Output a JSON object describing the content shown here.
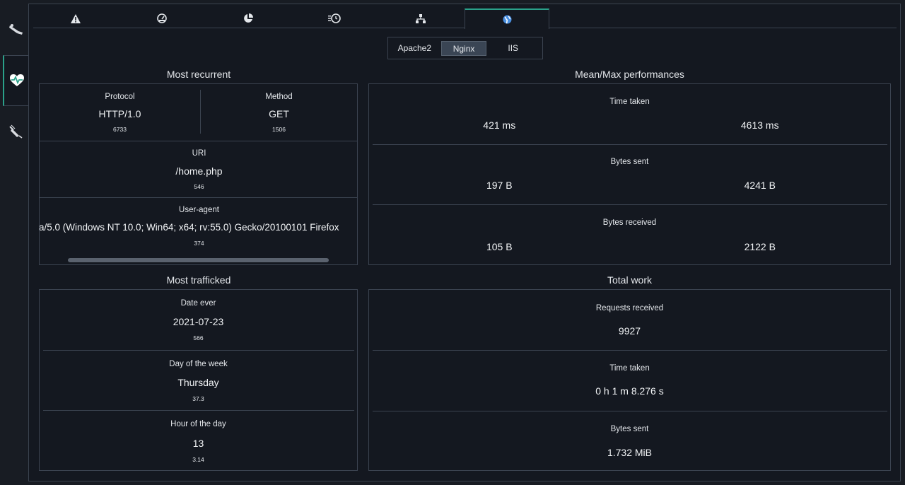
{
  "sidebar": {
    "items": [
      {
        "icon": "broom-icon",
        "active": false
      },
      {
        "icon": "heart-pulse-icon",
        "active": true
      },
      {
        "icon": "syringe-icon",
        "active": false
      }
    ]
  },
  "tabs": [
    {
      "icon": "warning-icon",
      "active": false
    },
    {
      "icon": "gauge-icon",
      "active": false
    },
    {
      "icon": "pie-chart-icon",
      "active": false
    },
    {
      "icon": "history-icon",
      "active": false
    },
    {
      "icon": "sitemap-icon",
      "active": false
    },
    {
      "icon": "globe-icon",
      "active": true
    }
  ],
  "server_selector": {
    "options": [
      "Apache2",
      "Nginx",
      "IIS"
    ],
    "selected": "Nginx"
  },
  "most_recurrent": {
    "title": "Most recurrent",
    "protocol": {
      "label": "Protocol",
      "value": "HTTP/1.0",
      "count": "6733"
    },
    "method": {
      "label": "Method",
      "value": "GET",
      "count": "1506"
    },
    "uri": {
      "label": "URI",
      "value": "/home.php",
      "count": "546"
    },
    "user_agent": {
      "label": "User-agent",
      "value": "a/5.0 (Windows NT 10.0; Win64; x64; rv:55.0) Gecko/20100101 Firefox",
      "count": "374"
    }
  },
  "mean_max": {
    "title": "Mean/Max performances",
    "time_taken": {
      "label": "Time taken",
      "mean": "421 ms",
      "max": "4613 ms"
    },
    "bytes_sent": {
      "label": "Bytes sent",
      "mean": "197 B",
      "max": "4241 B"
    },
    "bytes_received": {
      "label": "Bytes received",
      "mean": "105 B",
      "max": "2122 B"
    }
  },
  "most_trafficked": {
    "title": "Most trafficked",
    "date_ever": {
      "label": "Date ever",
      "value": "2021-07-23",
      "count": "566"
    },
    "day_of_week": {
      "label": "Day of the week",
      "value": "Thursday",
      "count": "37.3"
    },
    "hour_of_day": {
      "label": "Hour of the day",
      "value": "13",
      "count": "3.14"
    }
  },
  "total_work": {
    "title": "Total work",
    "requests_received": {
      "label": "Requests received",
      "value": "9927"
    },
    "time_taken": {
      "label": "Time taken",
      "value": "0 h 1 m 8.276 s"
    },
    "bytes_sent": {
      "label": "Bytes sent",
      "value": "1.732 MiB"
    }
  },
  "colors": {
    "accent": "#2aa18a",
    "border": "#3b4350",
    "background": "#181c23"
  }
}
